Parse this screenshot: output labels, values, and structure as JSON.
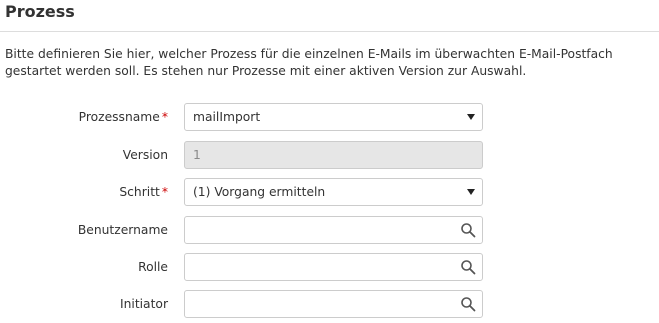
{
  "section": {
    "title": "Prozess",
    "description": "Bitte definieren Sie hier, welcher Prozess für die einzelnen E-Mails im überwachten E-Mail-Postfach gestartet werden soll. Es stehen nur Prozesse mit einer aktiven Version zur Auswahl."
  },
  "form": {
    "required_marker": "*",
    "process_name": {
      "label": "Prozessname",
      "value": "mailImport",
      "icon": "chevron-down-icon"
    },
    "version": {
      "label": "Version",
      "value": "1"
    },
    "step": {
      "label": "Schritt",
      "value": "(1) Vorgang ermitteln",
      "icon": "chevron-down-icon"
    },
    "username": {
      "label": "Benutzername",
      "value": "",
      "icon": "search-icon"
    },
    "role": {
      "label": "Rolle",
      "value": "",
      "icon": "search-icon"
    },
    "initiator": {
      "label": "Initiator",
      "value": "",
      "icon": "search-icon"
    }
  },
  "colors": {
    "required": "#cc0000",
    "border": "#cccccc",
    "readonly_bg": "#e6e6e6"
  }
}
